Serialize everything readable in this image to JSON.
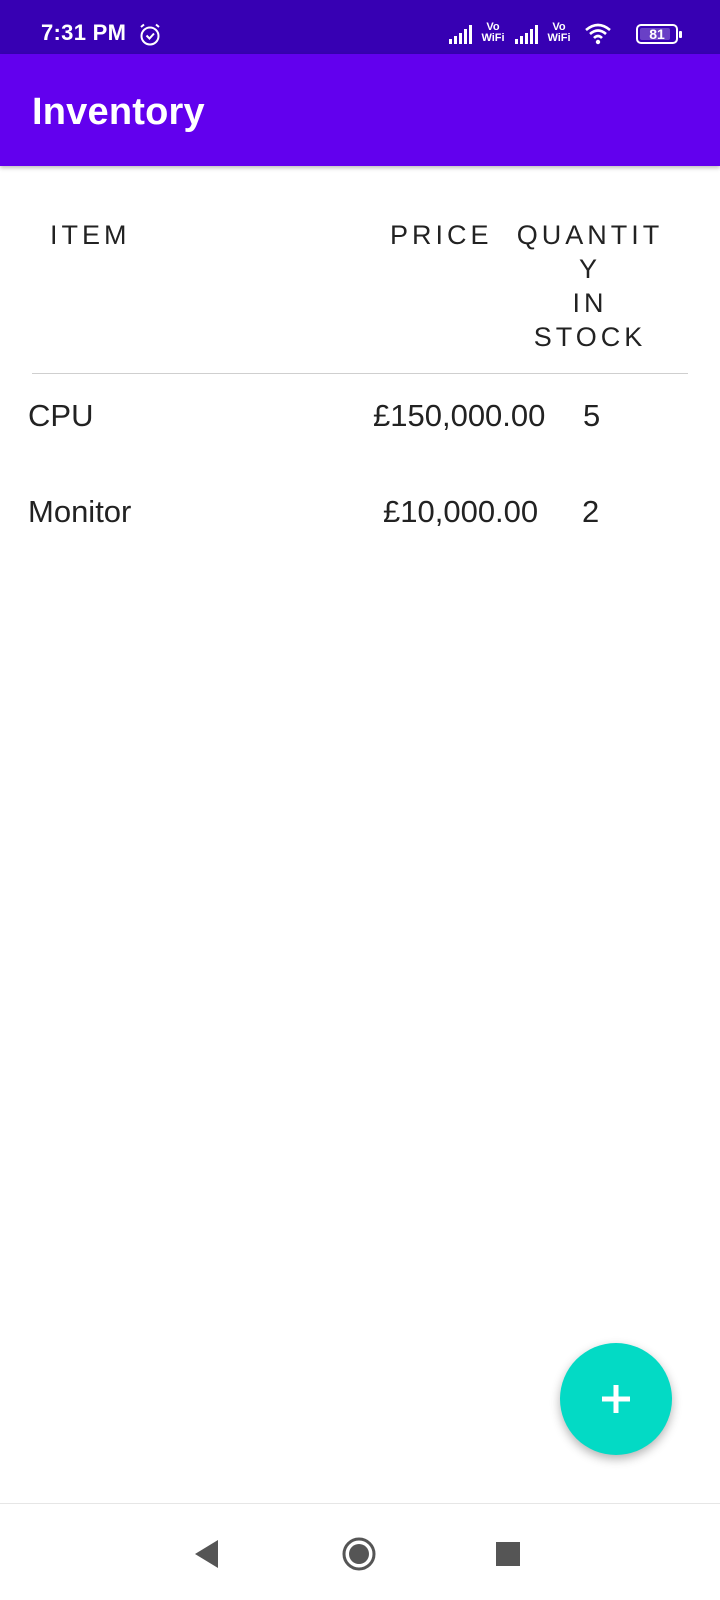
{
  "status_bar": {
    "time": "7:31 PM",
    "vowifi_1_top": "Vo",
    "vowifi_1_bottom": "WiFi",
    "vowifi_2_top": "Vo",
    "vowifi_2_bottom": "WiFi",
    "battery": "81",
    "background": "#3700b3"
  },
  "app_bar": {
    "title": "Inventory",
    "background": "#6200ee"
  },
  "table": {
    "headers": {
      "item": "ITEM",
      "price": "PRICE",
      "quantity_line1": "QUANTIT",
      "quantity_line2": "Y",
      "quantity_line3": "IN",
      "quantity_line4": "STOCK"
    },
    "rows": [
      {
        "item": "CPU",
        "price": "£150,000.00",
        "quantity": "5"
      },
      {
        "item": "Monitor",
        "price": "£10,000.00",
        "quantity": "2"
      }
    ]
  },
  "fab": {
    "icon": "plus-icon",
    "color": "#03dac5"
  },
  "nav_bar": {
    "back_icon": "back-triangle-icon",
    "home_icon": "home-circle-icon",
    "recents_icon": "recents-square-icon"
  }
}
